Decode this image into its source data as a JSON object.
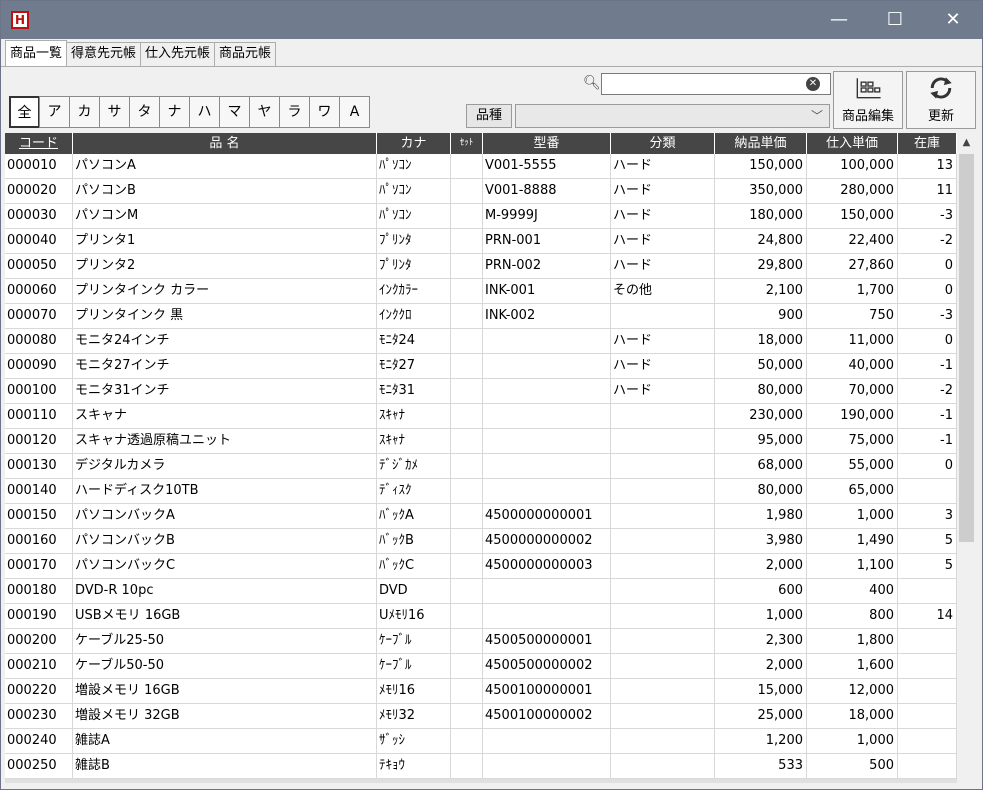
{
  "window": {
    "app_icon_letter": "H",
    "minimize": "—",
    "maximize": "☐",
    "close": "✕"
  },
  "tabs": [
    "商品一覧",
    "得意先元帳",
    "仕入先元帳",
    "商品元帳"
  ],
  "active_tab": 0,
  "kana_filter": [
    "全",
    "ア",
    "カ",
    "サ",
    "タ",
    "ナ",
    "ハ",
    "マ",
    "ヤ",
    "ラ",
    "ワ",
    "A"
  ],
  "active_kana": 0,
  "search": {
    "value": "",
    "placeholder": ""
  },
  "category": {
    "label": "品種",
    "value": ""
  },
  "buttons": {
    "edit": "商品編集",
    "refresh": "更新"
  },
  "columns": [
    "コード",
    "品 名",
    "カナ",
    "ｾｯﾄ",
    "型番",
    "分類",
    "納品単価",
    "仕入単価",
    "在庫"
  ],
  "rows": [
    [
      "000010",
      "パソコンA",
      "ﾊﾟｿｺﾝ",
      "",
      "V001-5555",
      "ハード",
      "150,000",
      "100,000",
      "13"
    ],
    [
      "000020",
      "パソコンB",
      "ﾊﾟｿｺﾝ",
      "",
      "V001-8888",
      "ハード",
      "350,000",
      "280,000",
      "11"
    ],
    [
      "000030",
      "パソコンM",
      "ﾊﾟｿｺﾝ",
      "",
      "M-9999J",
      "ハード",
      "180,000",
      "150,000",
      "-3"
    ],
    [
      "000040",
      "プリンタ1",
      "ﾌﾟﾘﾝﾀ",
      "",
      "PRN-001",
      "ハード",
      "24,800",
      "22,400",
      "-2"
    ],
    [
      "000050",
      "プリンタ2",
      "ﾌﾟﾘﾝﾀ",
      "",
      "PRN-002",
      "ハード",
      "29,800",
      "27,860",
      "0"
    ],
    [
      "000060",
      "プリンタインク カラー",
      "ｲﾝｸｶﾗｰ",
      "",
      "INK-001",
      "その他",
      "2,100",
      "1,700",
      "0"
    ],
    [
      "000070",
      "プリンタインク 黒",
      "ｲﾝｸｸﾛ",
      "",
      "INK-002",
      "",
      "900",
      "750",
      "-3"
    ],
    [
      "000080",
      "モニタ24インチ",
      "ﾓﾆﾀ24",
      "",
      "",
      "ハード",
      "18,000",
      "11,000",
      "0"
    ],
    [
      "000090",
      "モニタ27インチ",
      "ﾓﾆﾀ27",
      "",
      "",
      "ハード",
      "50,000",
      "40,000",
      "-1"
    ],
    [
      "000100",
      "モニタ31インチ",
      "ﾓﾆﾀ31",
      "",
      "",
      "ハード",
      "80,000",
      "70,000",
      "-2"
    ],
    [
      "000110",
      "スキャナ",
      "ｽｷｬﾅ",
      "",
      "",
      "",
      "230,000",
      "190,000",
      "-1"
    ],
    [
      "000120",
      "スキャナ透過原稿ユニット",
      "ｽｷｬﾅ",
      "",
      "",
      "",
      "95,000",
      "75,000",
      "-1"
    ],
    [
      "000130",
      "デジタルカメラ",
      "ﾃﾞｼﾞｶﾒ",
      "",
      "",
      "",
      "68,000",
      "55,000",
      "0"
    ],
    [
      "000140",
      "ハードディスク10TB",
      "ﾃﾞｨｽｸ",
      "",
      "",
      "",
      "80,000",
      "65,000",
      ""
    ],
    [
      "000150",
      "パソコンバックA",
      "ﾊﾞｯｸA",
      "",
      "4500000000001",
      "",
      "1,980",
      "1,000",
      "3"
    ],
    [
      "000160",
      "パソコンバックB",
      "ﾊﾞｯｸB",
      "",
      "4500000000002",
      "",
      "3,980",
      "1,490",
      "5"
    ],
    [
      "000170",
      "パソコンバックC",
      "ﾊﾞｯｸC",
      "",
      "4500000000003",
      "",
      "2,000",
      "1,100",
      "5"
    ],
    [
      "000180",
      "DVD-R 10pc",
      "DVD",
      "",
      "",
      "",
      "600",
      "400",
      ""
    ],
    [
      "000190",
      "USBメモリ 16GB",
      "Uﾒﾓﾘ16",
      "",
      "",
      "",
      "1,000",
      "800",
      "14"
    ],
    [
      "000200",
      "ケーブル25-50",
      "ｹｰﾌﾞﾙ",
      "",
      "4500500000001",
      "",
      "2,300",
      "1,800",
      ""
    ],
    [
      "000210",
      "ケーブル50-50",
      "ｹｰﾌﾞﾙ",
      "",
      "4500500000002",
      "",
      "2,000",
      "1,600",
      ""
    ],
    [
      "000220",
      "増設メモリ 16GB",
      "ﾒﾓﾘ16",
      "",
      "4500100000001",
      "",
      "15,000",
      "12,000",
      ""
    ],
    [
      "000230",
      "増設メモリ 32GB",
      "ﾒﾓﾘ32",
      "",
      "4500100000002",
      "",
      "25,000",
      "18,000",
      ""
    ],
    [
      "000240",
      "雑誌A",
      "ｻﾞｯｼ",
      "",
      "",
      "",
      "1,200",
      "1,000",
      ""
    ],
    [
      "000250",
      "雑誌B",
      "ﾃｷｮｳ",
      "",
      "",
      "",
      "533",
      "500",
      ""
    ]
  ]
}
